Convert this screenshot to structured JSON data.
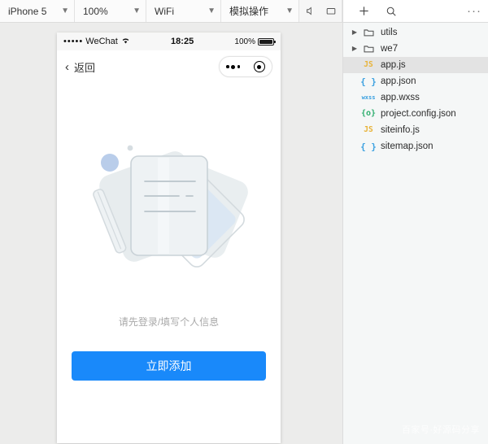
{
  "toolbar": {
    "device": {
      "label": "iPhone 5",
      "caret": "chevron-down"
    },
    "zoom": {
      "label": "100%",
      "caret": "chevron-down"
    },
    "network": {
      "label": "WiFi",
      "caret": "chevron-down"
    },
    "simulate": {
      "label": "模拟操作",
      "caret": "chevron-down"
    },
    "mute_icon": "speaker-mute-icon",
    "screen_icon": "screen-icon",
    "add_icon": "plus-icon",
    "search_icon": "search-icon",
    "overflow": "···"
  },
  "simulator": {
    "statusbar": {
      "signal_dots": "•••••",
      "carrier": "WeChat",
      "wifi_icon": "wifi-icon",
      "time": "18:25",
      "battery_percent": "100%",
      "battery_icon": "battery-full-icon"
    },
    "navbar": {
      "back_label": "返回",
      "back_chevron": "‹",
      "capsule": {
        "more_icon": "more-dots-icon",
        "target_icon": "target-circle-icon"
      }
    },
    "page": {
      "illustration": "empty-document-illustration",
      "hint_text": "请先登录/填写个人信息",
      "cta_label": "立即添加",
      "cta_color": "#1989fa"
    }
  },
  "explorer": {
    "files": [
      {
        "name": "utils",
        "icon": "folder-icon",
        "kind": "folder",
        "expandable": true,
        "selected": false
      },
      {
        "name": "we7",
        "icon": "folder-icon",
        "kind": "folder",
        "expandable": true,
        "selected": false
      },
      {
        "name": "app.js",
        "icon": "js-file-icon",
        "kind": "js",
        "glyph": "JS",
        "expandable": false,
        "selected": true
      },
      {
        "name": "app.json",
        "icon": "json-file-icon",
        "kind": "json",
        "glyph": "{ }",
        "expandable": false,
        "selected": false
      },
      {
        "name": "app.wxss",
        "icon": "wxss-file-icon",
        "kind": "wxss",
        "glyph": "wxss",
        "expandable": false,
        "selected": false
      },
      {
        "name": "project.config.json",
        "icon": "config-file-icon",
        "kind": "cfg",
        "glyph": "{o}",
        "expandable": false,
        "selected": false
      },
      {
        "name": "siteinfo.js",
        "icon": "js-file-icon",
        "kind": "js",
        "glyph": "JS",
        "expandable": false,
        "selected": false
      },
      {
        "name": "sitemap.json",
        "icon": "json-file-icon",
        "kind": "json",
        "glyph": "{ }",
        "expandable": false,
        "selected": false
      }
    ]
  },
  "watermark": {
    "text": "百家号·好源码分享"
  }
}
